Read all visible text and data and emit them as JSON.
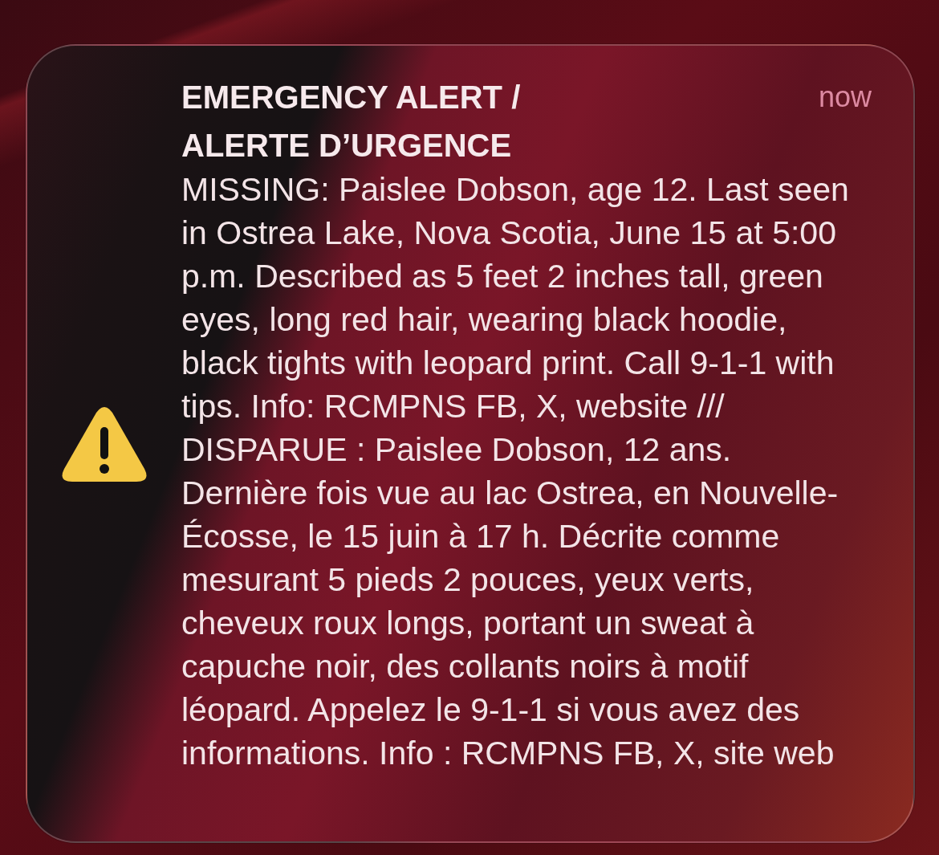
{
  "notification": {
    "title": "EMERGENCY ALERT / ALERTE D’URGENCE",
    "time": "now",
    "message": "MISSING: Paislee Dobson, age 12. Last seen in Ostrea Lake, Nova Scotia, June 15 at 5:00 p.m. Described as 5 feet 2 inches tall, green eyes, long red hair, wearing black hoodie, black tights with leopard print. Call 9-1-1 with tips. Info: RCMPNS FB, X, website /// DISPARUE : Paislee Dobson, 12 ans. Dernière fois vue au lac Ostrea, en Nouvelle-Écosse, le 15 juin à 17 h. Décrite comme mesurant 5 pieds 2 pouces, yeux verts, cheveux roux longs, portant un sweat à capuche noir, des collants noirs à motif léopard. Appelez le 9-1-1 si vous avez des informations. Info : RCMPNS FB, X, site web"
  }
}
